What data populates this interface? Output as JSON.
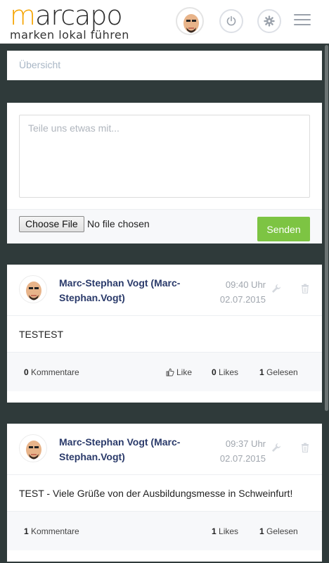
{
  "header": {
    "logo_prefix": "m",
    "logo_rest": "arcapo",
    "tagline": "marken lokal führen"
  },
  "overview": {
    "label": "Übersicht"
  },
  "compose": {
    "placeholder": "Teile uns etwas mit...",
    "file_button": "Choose File",
    "file_status": "No file chosen",
    "send_label": "Senden",
    "send_color": "#7dc443"
  },
  "posts": [
    {
      "author": "Marc-Stephan Vogt (Marc-Stephan.Vogt)",
      "time": "09:40 Uhr",
      "date": "02.07.2015",
      "text": "TESTEST",
      "comments_count": "0",
      "comments_label": "Kommentare",
      "like_label": "Like",
      "likes_count": "0",
      "likes_label": "Likes",
      "read_count": "1",
      "read_label": "Gelesen"
    },
    {
      "author": "Marc-Stephan Vogt (Marc-Stephan.Vogt)",
      "time": "09:37 Uhr",
      "date": "02.07.2015",
      "text": "TEST - Viele Grüße von der Ausbildungsmesse in Schweinfurt!",
      "comments_count": "1",
      "comments_label": "Kommentare",
      "likes_count": "1",
      "likes_label": "Likes",
      "read_count": "1",
      "read_label": "Gelesen"
    }
  ],
  "icons": {
    "power": "power-icon",
    "settings": "gear-icon",
    "menu": "hamburger-icon",
    "edit": "wrench-icon",
    "delete": "trash-icon",
    "like": "thumbs-up-icon"
  },
  "colors": {
    "brand_accent": "#f5a400",
    "background": "#2f3a3a",
    "author": "#2a3a6a"
  }
}
